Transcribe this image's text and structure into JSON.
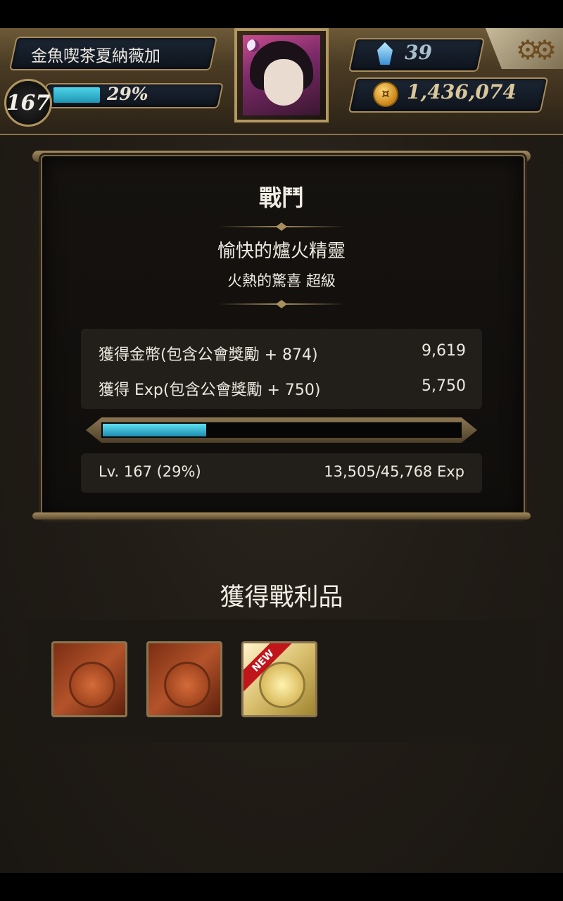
{
  "player": {
    "name": "金魚喫茶夏納薇加",
    "level": "167",
    "exp_percent_label": "29%",
    "exp_fraction": 0.29
  },
  "currency": {
    "gems": "39",
    "gold": "1,436,074"
  },
  "battle": {
    "title": "戰鬥",
    "quest_name": "愉快的爐火精靈",
    "quest_sub": "火熱的驚喜 超級",
    "rewards": [
      {
        "label": "獲得金幣(包含公會獎勵 + 874)",
        "value": "9,619"
      },
      {
        "label": "獲得 Exp(包含公會獎勵 + 750)",
        "value": "5,750"
      }
    ],
    "level_line": "Lv. 167 (29%)",
    "exp_line": "13,505/45,768 Exp",
    "exp_fraction": 0.29
  },
  "loot": {
    "title": "獲得戰利品",
    "items": [
      {
        "kind": "bronze-card"
      },
      {
        "kind": "bronze-card"
      },
      {
        "kind": "gold-card",
        "badge": "NEW"
      }
    ]
  },
  "colors": {
    "accent_cyan": "#3fc6e0",
    "frame_gold": "#a88c5a",
    "new_badge_red": "#c0151b"
  },
  "icons": [
    "moon-icon",
    "gem-icon",
    "coin-icon",
    "gear-icon"
  ]
}
